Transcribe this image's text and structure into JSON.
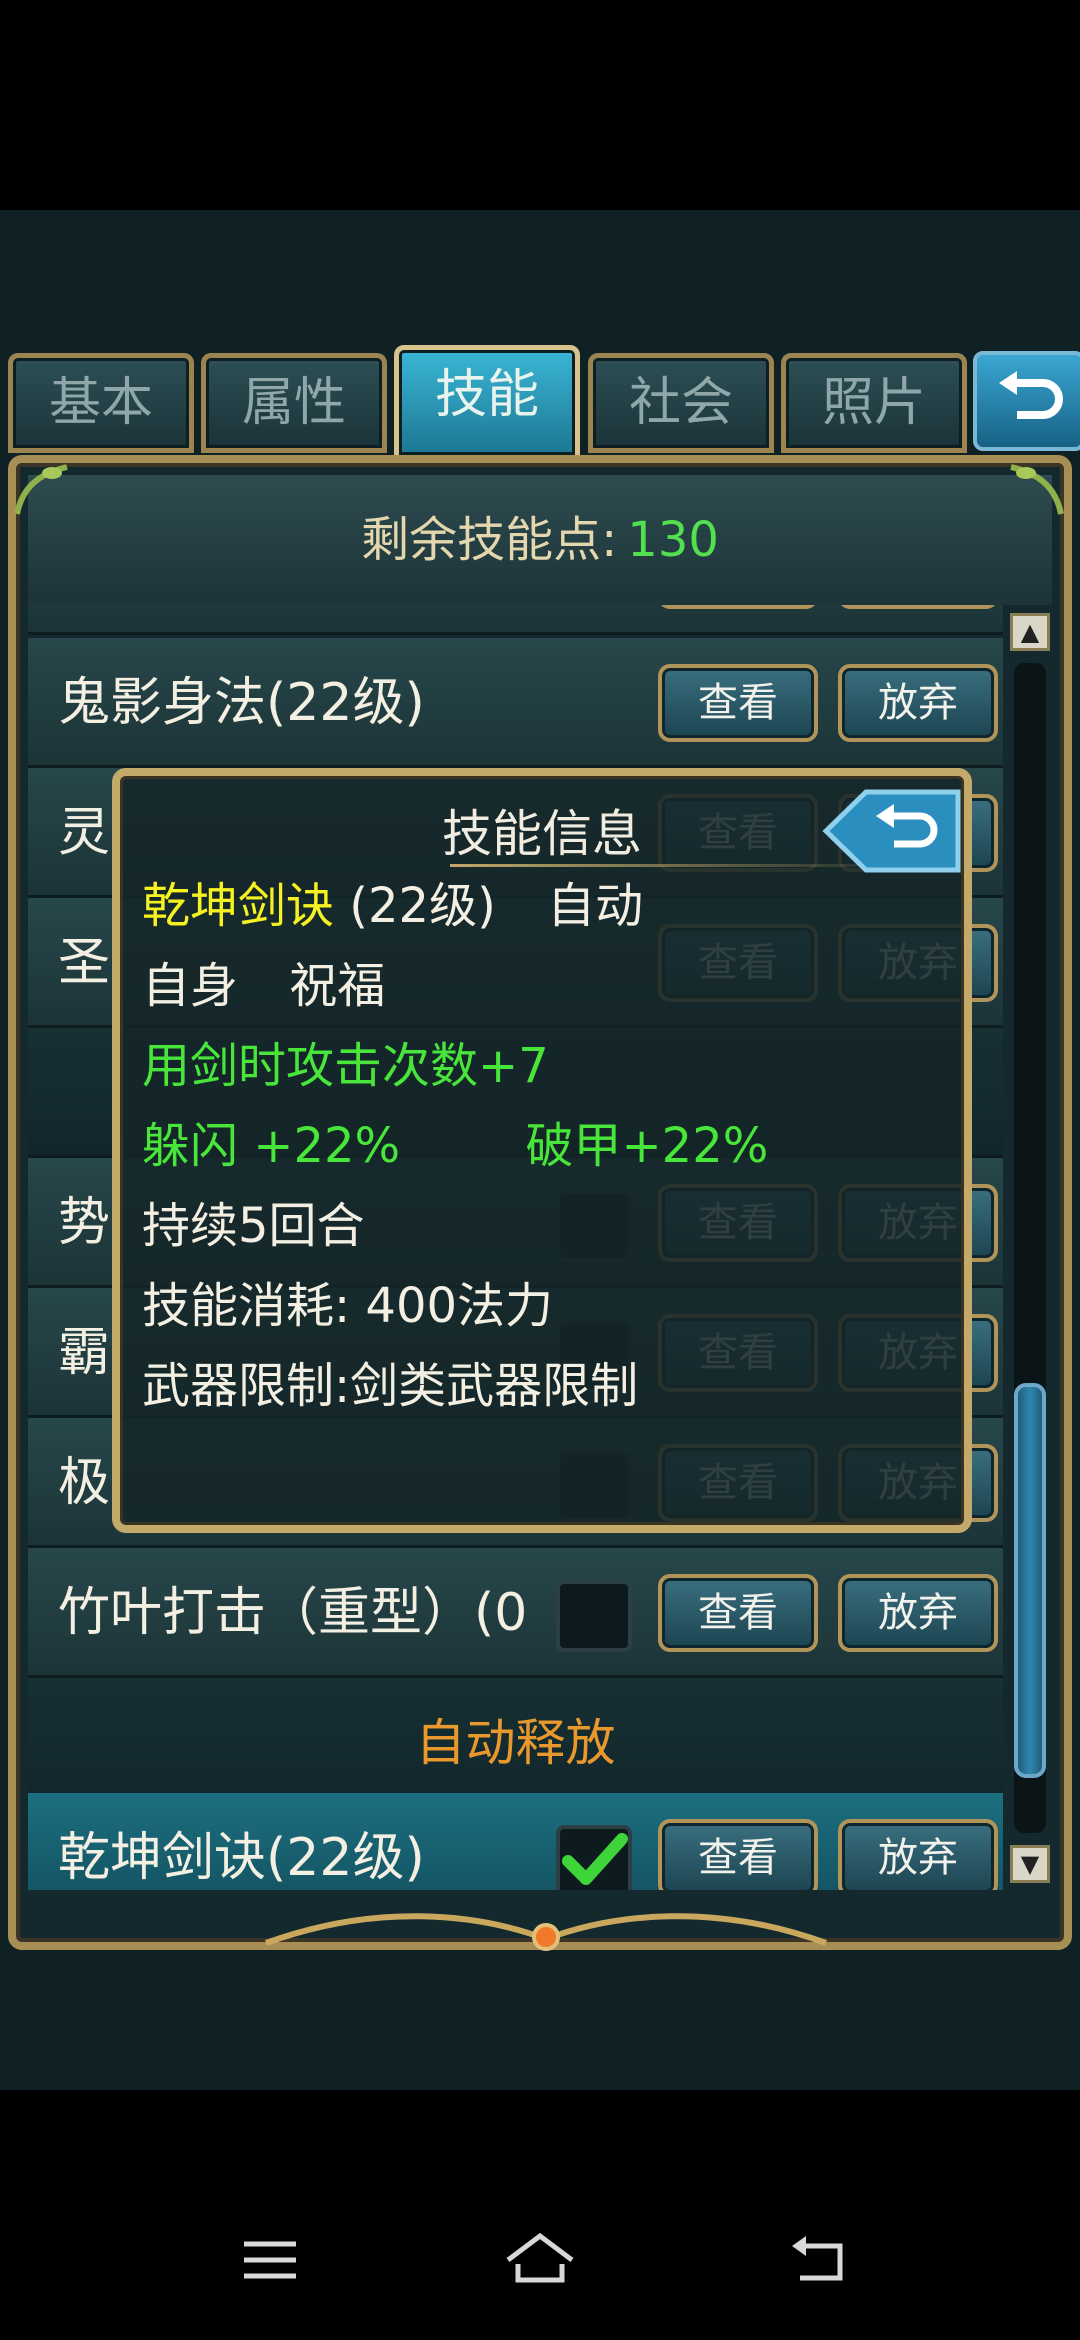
{
  "tabs": [
    {
      "label": "基本"
    },
    {
      "label": "属性"
    },
    {
      "label": "技能",
      "active": true
    },
    {
      "label": "社会"
    },
    {
      "label": "照片"
    }
  ],
  "points": {
    "label": "剩余技能点:",
    "value": "130"
  },
  "rows": [
    {
      "name": "鬼影身法(22级)"
    },
    {
      "name": "灵"
    },
    {
      "name": "圣"
    },
    {
      "name": "势"
    },
    {
      "name": "霸"
    },
    {
      "name": "极"
    },
    {
      "name": "竹叶打击（重型）(0"
    },
    {
      "name": "乾坤剑诀(22级)",
      "checked": true,
      "check_count": "1"
    }
  ],
  "section_header": "自动释放",
  "buttons": {
    "view": "查看",
    "drop": "放弃"
  },
  "popup": {
    "title": "技能信息",
    "skill_name": "乾坤剑诀",
    "skill_level": "(22级)",
    "skill_mode": "自动",
    "target": "自身",
    "type": "祝福",
    "effect1": "用剑时攻击次数+7",
    "effect2a": "躲闪 +22%",
    "effect2b": "破甲+22%",
    "duration": "持续5回合",
    "cost": "技能消耗: 400法力",
    "restriction": "武器限制:剑类武器限制"
  },
  "colors": {
    "accent_gold": "#c3a96a",
    "highlight_green": "#48e63a",
    "highlight_yellow": "#f6f120",
    "orange": "#e8982c"
  }
}
